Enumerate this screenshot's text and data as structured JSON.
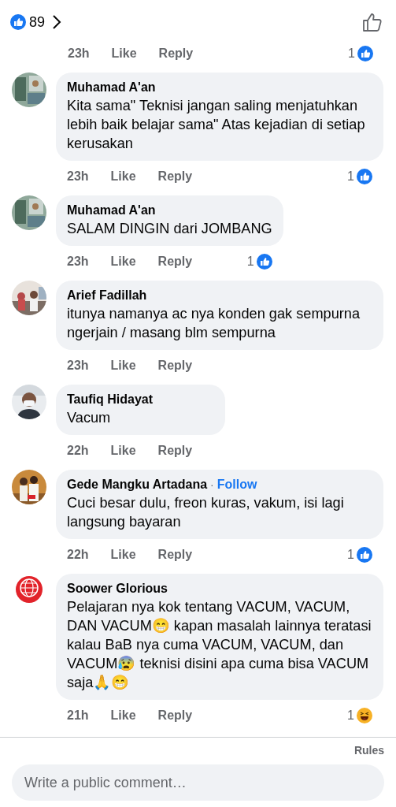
{
  "reactions_summary": {
    "count": "89"
  },
  "first_actions": {
    "time": "23h",
    "like": "Like",
    "reply": "Reply",
    "reaction": {
      "count": "1",
      "kind": "like"
    }
  },
  "comments": [
    {
      "author": "Muhamad A'an",
      "text": "Kita sama\" Teknisi jangan saling menjatuhkan lebih baik belajar sama\" Atas kejadian di setiap kerusakan",
      "time": "23h",
      "like": "Like",
      "reply": "Reply",
      "reaction": {
        "count": "1",
        "kind": "like"
      }
    },
    {
      "author": "Muhamad A'an",
      "text": "SALAM DINGIN dari JOMBANG",
      "time": "23h",
      "like": "Like",
      "reply": "Reply",
      "reaction": {
        "count": "1",
        "kind": "like"
      }
    },
    {
      "author": "Arief Fadillah",
      "text": "itunya namanya ac nya konden gak sempurna ngerjain / masang blm sempurna",
      "time": "23h",
      "like": "Like",
      "reply": "Reply"
    },
    {
      "author": "Taufiq Hidayat",
      "text": "Vacum",
      "time": "22h",
      "like": "Like",
      "reply": "Reply"
    },
    {
      "author": "Gede Mangku Artadana",
      "follow": {
        "separator": "·",
        "label": "Follow"
      },
      "text": "Cuci besar dulu, freon kuras, vakum, isi lagi langsung bayaran",
      "time": "22h",
      "like": "Like",
      "reply": "Reply",
      "reaction": {
        "count": "1",
        "kind": "like"
      }
    },
    {
      "author": "Soower Glorious",
      "text": "Pelajaran nya kok tentang VACUM, VACUM, DAN VACUM😁 kapan masalah lainnya teratasi kalau BaB nya cuma VACUM, VACUM, dan VACUM😰 teknisi disini apa cuma bisa VACUM saja🙏😁",
      "time": "21h",
      "like": "Like",
      "reply": "Reply",
      "reaction": {
        "count": "1",
        "kind": "haha"
      }
    }
  ],
  "rules_link": "Rules",
  "comment_field": {
    "placeholder": "Write a public comment…"
  }
}
